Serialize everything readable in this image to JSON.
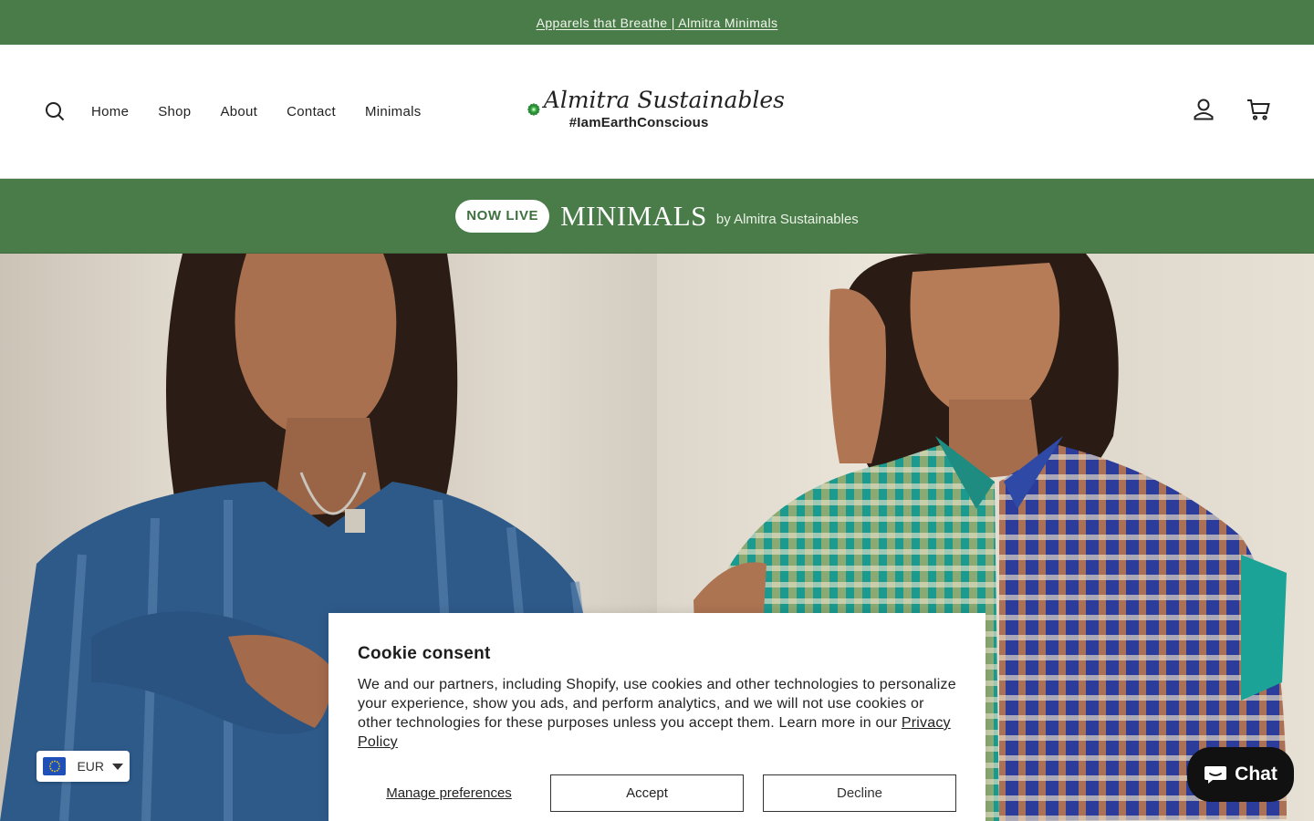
{
  "announcement": {
    "text": "Apparels that Breathe | Almitra Minimals"
  },
  "nav": {
    "items": [
      {
        "label": "Home"
      },
      {
        "label": "Shop"
      },
      {
        "label": "About"
      },
      {
        "label": "Contact"
      },
      {
        "label": "Minimals"
      }
    ]
  },
  "logo": {
    "title": "Almitra Sustainables",
    "tagline": "#IamEarthConscious",
    "icon": "green-mandala-logo"
  },
  "header_icons": {
    "search": "search-icon",
    "account": "account-icon",
    "cart": "cart-icon"
  },
  "promo": {
    "badge": "NOW LIVE",
    "title": "MINIMALS",
    "subtitle": "by Almitra Sustainables"
  },
  "cookie": {
    "title": "Cookie consent",
    "body": "We and our partners, including Shopify, use cookies and other technologies to personalize your experience, show you ads, and perform analytics, and we will not use cookies or other technologies for these purposes unless you accept them. Learn more in our ",
    "link": "Privacy Policy",
    "manage": "Manage preferences",
    "accept": "Accept",
    "decline": "Decline"
  },
  "currency": {
    "code": "EUR"
  },
  "chat": {
    "label": "Chat"
  },
  "colors": {
    "brand_green": "#4a7c4a",
    "chat_bg": "#111111"
  }
}
